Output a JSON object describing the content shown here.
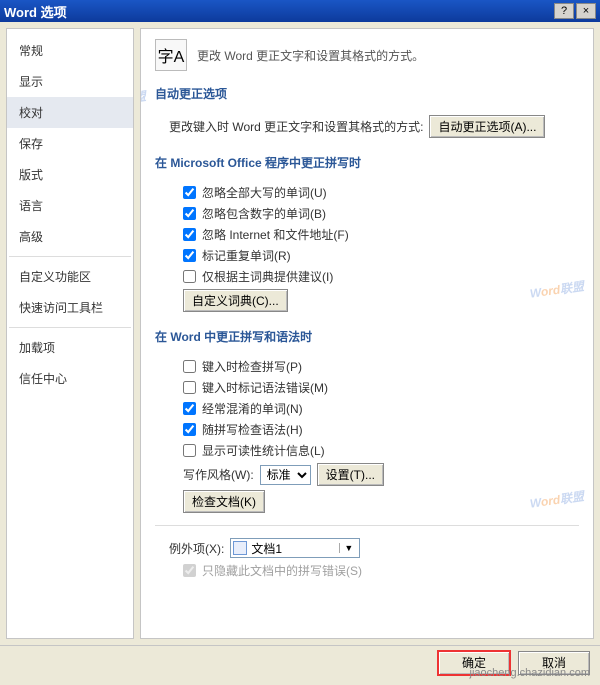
{
  "window": {
    "title": "Word 选项",
    "help": "?",
    "close": "×"
  },
  "watermark": {
    "a": "W",
    "b": "ord",
    "c": "联盟"
  },
  "sidebar": {
    "items": [
      {
        "label": "常规"
      },
      {
        "label": "显示"
      },
      {
        "label": "校对",
        "selected": true
      },
      {
        "label": "保存"
      },
      {
        "label": "版式"
      },
      {
        "label": "语言"
      },
      {
        "label": "高级"
      },
      {
        "label": "自定义功能区"
      },
      {
        "label": "快速访问工具栏"
      },
      {
        "label": "加载项"
      },
      {
        "label": "信任中心"
      }
    ]
  },
  "header": {
    "icon": "字A",
    "text": "更改 Word 更正文字和设置其格式的方式。"
  },
  "autoCorrect": {
    "title": "自动更正选项",
    "desc": "更改键入时 Word 更正文字和设置其格式的方式:",
    "btn": "自动更正选项(A)..."
  },
  "spellOffice": {
    "title": "在 Microsoft Office 程序中更正拼写时",
    "c1": {
      "label": "忽略全部大写的单词(U)",
      "checked": true
    },
    "c2": {
      "label": "忽略包含数字的单词(B)",
      "checked": true
    },
    "c3": {
      "label": "忽略 Internet 和文件地址(F)",
      "checked": true
    },
    "c4": {
      "label": "标记重复单词(R)",
      "checked": true
    },
    "c5": {
      "label": "仅根据主词典提供建议(I)",
      "checked": false
    },
    "dictBtn": "自定义词典(C)..."
  },
  "spellWord": {
    "title": "在 Word 中更正拼写和语法时",
    "c1": {
      "label": "键入时检查拼写(P)",
      "checked": false
    },
    "c2": {
      "label": "键入时标记语法错误(M)",
      "checked": false
    },
    "c3": {
      "label": "经常混淆的单词(N)",
      "checked": true
    },
    "c4": {
      "label": "随拼写检查语法(H)",
      "checked": true
    },
    "c5": {
      "label": "显示可读性统计信息(L)",
      "checked": false
    },
    "styleLabel": "写作风格(W):",
    "styleValue": "标准",
    "settingsBtn": "设置(T)...",
    "recheckBtn": "检查文档(K)"
  },
  "exceptions": {
    "label": "例外项(X):",
    "value": "文档1",
    "c1": {
      "label": "只隐藏此文档中的拼写错误(S)",
      "checked": true
    }
  },
  "buttons": {
    "ok": "确定",
    "cancel": "取消"
  },
  "corner": "jiaocheng.chazidian.com"
}
